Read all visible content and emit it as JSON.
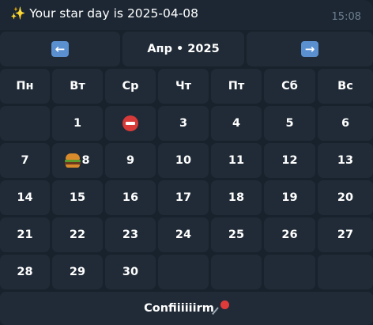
{
  "message": {
    "text": "✨ Your star day is 2025-04-08",
    "time": "15:08"
  },
  "nav": {
    "prev_icon": "left-arrow-icon",
    "next_icon": "right-arrow-icon",
    "month_label": "Апр • 2025"
  },
  "weekdays": [
    "Пн",
    "Вт",
    "Ср",
    "Чт",
    "Пт",
    "Сб",
    "Вс"
  ],
  "weeks": [
    [
      "",
      "1",
      "",
      "3",
      "4",
      "5",
      "6"
    ],
    [
      "7",
      "8",
      "9",
      "10",
      "11",
      "12",
      "13"
    ],
    [
      "14",
      "15",
      "16",
      "17",
      "18",
      "19",
      "20"
    ],
    [
      "21",
      "22",
      "23",
      "24",
      "25",
      "26",
      "27"
    ],
    [
      "28",
      "29",
      "30",
      "",
      "",
      "",
      ""
    ]
  ],
  "special_days": {
    "blocked_day_icon": "no-entry-icon",
    "selected_day_icon": "burger-icon"
  },
  "confirm": {
    "label": "Confiiiiiirm",
    "icon": "pushpin-icon"
  },
  "colors": {
    "background": "#18222d",
    "button": "#202b37",
    "text": "#ffffff",
    "time": "#6d7f8f"
  }
}
